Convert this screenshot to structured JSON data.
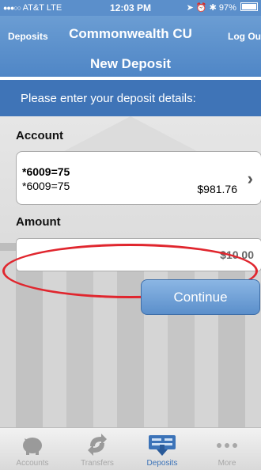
{
  "status_bar": {
    "signal": "●●●○○",
    "carrier": "AT&T",
    "network": "LTE",
    "time": "12:03 PM",
    "battery": "97%"
  },
  "nav": {
    "back_label": "Deposits",
    "title": "Commonwealth CU",
    "logout_label": "Log Out",
    "subtitle": "New Deposit"
  },
  "banner": {
    "text": "Please enter your deposit details:"
  },
  "account": {
    "section_label": "Account",
    "name": "*6009=75",
    "number": "*6009=75",
    "balance": "$981.76"
  },
  "amount": {
    "section_label": "Amount",
    "value": "$10.00"
  },
  "continue_label": "Continue",
  "tabs": [
    {
      "label": "Accounts",
      "icon": "piggy-bank-icon",
      "active": false
    },
    {
      "label": "Transfers",
      "icon": "transfer-arrows-icon",
      "active": false
    },
    {
      "label": "Deposits",
      "icon": "check-deposit-icon",
      "active": true
    },
    {
      "label": "More",
      "icon": "more-dots-icon",
      "active": false
    }
  ],
  "colors": {
    "nav": "#5b8fcb",
    "banner": "#3f74b7",
    "highlight": "#e0262e",
    "active_tab": "#3c73b8"
  }
}
